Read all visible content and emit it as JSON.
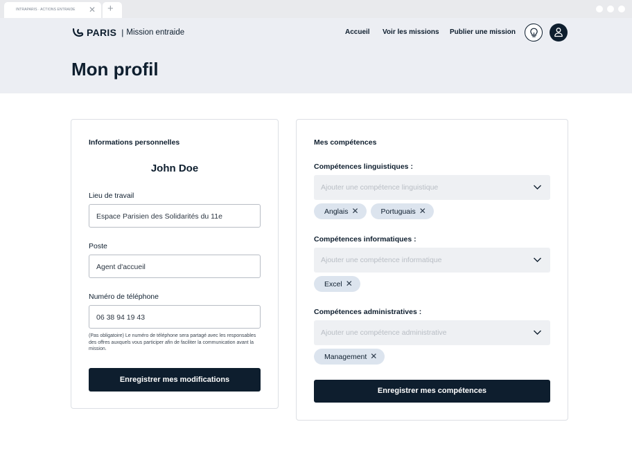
{
  "browser": {
    "tab_title": "INTRAPARIS · ACTIONS ENTRAIDE",
    "tab_close": "✕",
    "new_tab": "+"
  },
  "header": {
    "brand": "PARIS",
    "separator": "|",
    "subtitle": "Mission entraide",
    "nav": [
      "Accueil",
      "Voir les missions",
      "Publier une mission"
    ],
    "icons": [
      "lightbulb-icon",
      "user-icon"
    ]
  },
  "page": {
    "title": "Mon profil"
  },
  "personal": {
    "heading": "Informations personnelles",
    "name": "John Doe",
    "workplace_label": "Lieu de travail",
    "workplace_value": "Espace Parisien des Solidarités du 11e",
    "position_label": "Poste",
    "position_value": "Agent d'accueil",
    "phone_label": "Numéro de téléphone",
    "phone_value": "06 38 94 19 43",
    "phone_note": "(Pas obligatoire) Le numéro de téléphone sera partagé avec les responsables des offres auxquels vous participer afin de faciliter la communication avant la mission.",
    "save_label": "Enregistrer mes modifications"
  },
  "skills": {
    "heading": "Mes compétences",
    "languages": {
      "label": "Compétences linguistiques :",
      "placeholder": "Ajouter une compétence linguistique",
      "chips": [
        "Anglais",
        "Portuguais"
      ]
    },
    "computer": {
      "label": "Compétences informatiques :",
      "placeholder": "Ajouter une compétence informatique",
      "chips": [
        "Excel"
      ]
    },
    "admin": {
      "label": "Compétences administratives :",
      "placeholder": "Ajouter une compétence administrative",
      "chips": [
        "Management"
      ]
    },
    "chip_remove": "✕",
    "save_label": "Enregistrer mes compétences"
  },
  "colors": {
    "primary": "#0e1e2e",
    "header_bg": "#eceef3",
    "chip_bg": "#dce4ee",
    "select_bg": "#eef0f3"
  }
}
